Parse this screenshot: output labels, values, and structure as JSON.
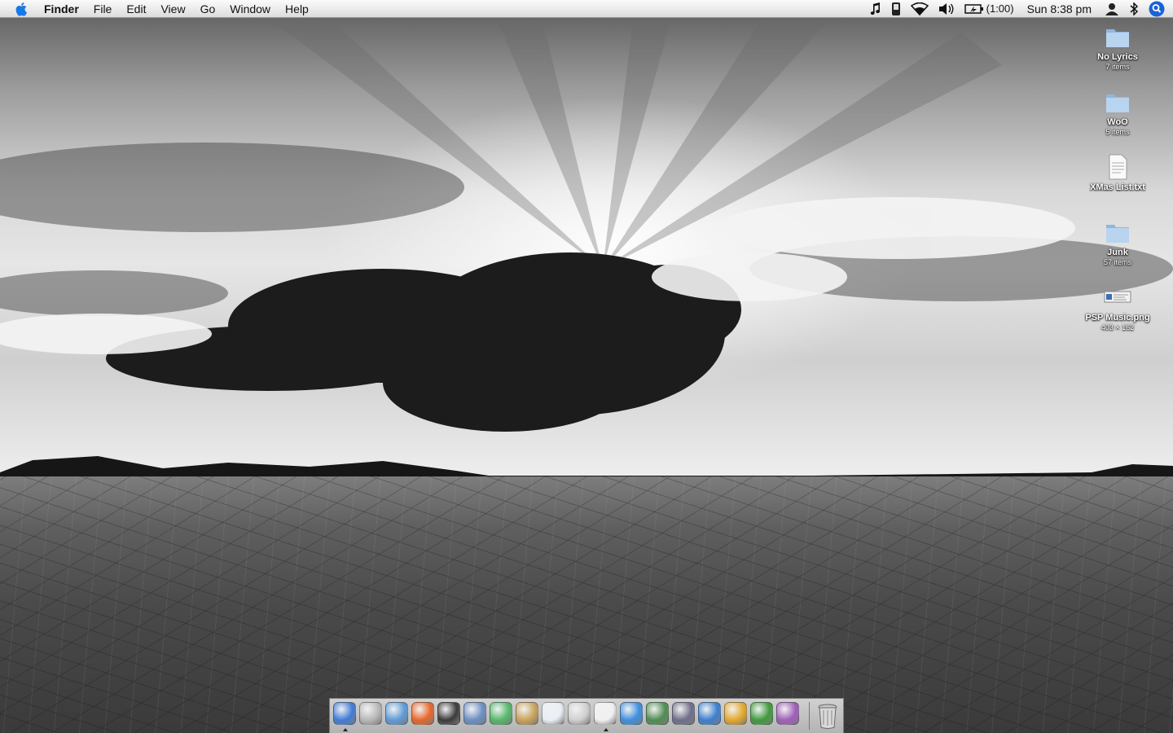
{
  "menubar": {
    "apple_icon": "apple-logo-icon",
    "app_name": "Finder",
    "menus": [
      "File",
      "Edit",
      "View",
      "Go",
      "Window",
      "Help"
    ],
    "status": {
      "battery_time": "(1:00)",
      "clock": "Sun 8:38 pm",
      "icons": [
        "music-note-icon",
        "phone-icon",
        "wifi-icon",
        "volume-icon",
        "battery-icon",
        "user-icon",
        "bluetooth-icon",
        "spotlight-icon"
      ]
    },
    "accent": "#1a78e6"
  },
  "desktop_icons": [
    {
      "name": "No Lyrics",
      "sub": "7 items",
      "icon": "folder-icon"
    },
    {
      "name": "WoO",
      "sub": "5 items",
      "icon": "folder-icon"
    },
    {
      "name": "XMas List.txt",
      "sub": "",
      "icon": "text-document-icon"
    },
    {
      "name": "Junk",
      "sub": "57 items",
      "icon": "folder-icon"
    },
    {
      "name": "PSP Music.png",
      "sub": "403 × 162",
      "icon": "image-file-icon"
    }
  ],
  "dock": {
    "apps": [
      {
        "icon": "finder-icon",
        "color": "#3f7bd6",
        "running": true
      },
      {
        "icon": "dvd-player-icon",
        "color": "#b8b8b8",
        "running": false
      },
      {
        "icon": "safari-icon",
        "color": "#5e9bd6",
        "running": false
      },
      {
        "icon": "firefox-icon",
        "color": "#e8662a",
        "running": false
      },
      {
        "icon": "terminal-icon",
        "color": "#3a3a3a",
        "running": false
      },
      {
        "icon": "preview-icon",
        "color": "#6b8fc2",
        "running": false
      },
      {
        "icon": "itunes-icon",
        "color": "#55b86a",
        "running": false
      },
      {
        "icon": "package-icon",
        "color": "#c9a35a",
        "running": false
      },
      {
        "icon": "mplayer-icon",
        "color": "#e9eef5",
        "running": false
      },
      {
        "icon": "script-editor-icon",
        "color": "#cfcfcf",
        "running": false
      },
      {
        "icon": "textedit-icon",
        "color": "#f0f0f0",
        "running": true
      },
      {
        "icon": "quicktime-icon",
        "color": "#3c8fe0",
        "running": false
      },
      {
        "icon": "guitar-tuner-icon",
        "color": "#4f8d52",
        "running": false
      },
      {
        "icon": "radio-icon",
        "color": "#6e6e8a",
        "running": false
      },
      {
        "icon": "xcode-icon",
        "color": "#3a7fd0",
        "running": false
      },
      {
        "icon": "transmit-icon",
        "color": "#e3a92b",
        "running": false
      },
      {
        "icon": "adium-icon",
        "color": "#3f9a3b",
        "running": false
      },
      {
        "icon": "web-ball-icon",
        "color": "#9f5fb8",
        "running": false
      }
    ],
    "trash_icon": "trash-icon"
  }
}
